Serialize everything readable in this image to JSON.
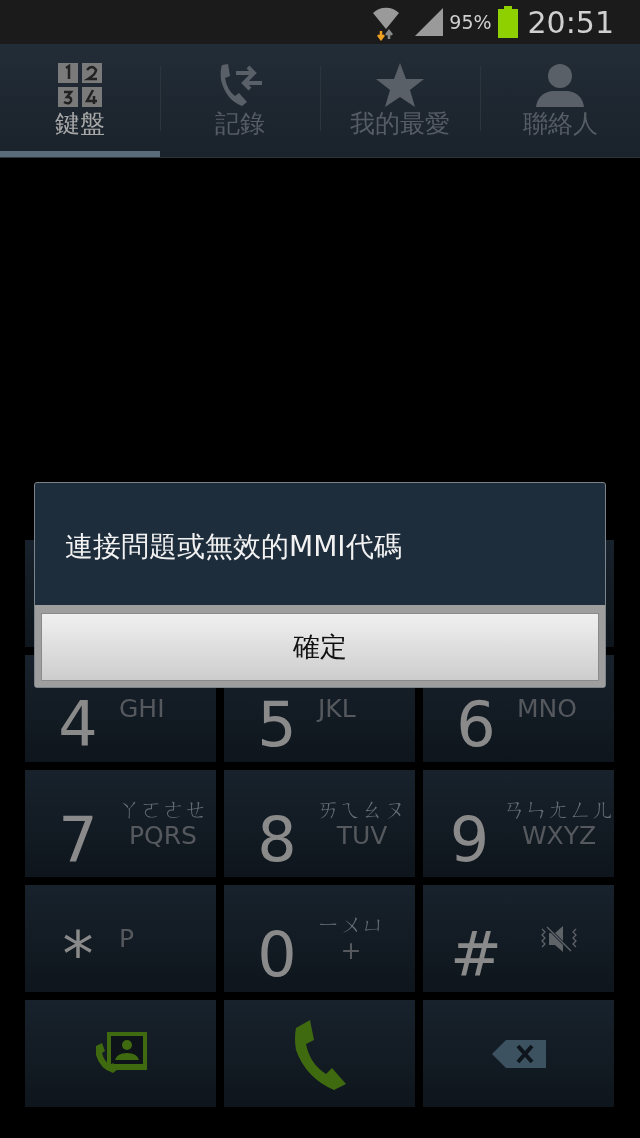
{
  "status_bar": {
    "battery": "95%",
    "time": "20:51"
  },
  "tabs": [
    {
      "label": "鍵盤",
      "selected": true
    },
    {
      "label": "記錄",
      "selected": false
    },
    {
      "label": "我的最愛",
      "selected": false
    },
    {
      "label": "聯絡人",
      "selected": false
    }
  ],
  "keypad": [
    {
      "kind": "digit",
      "digit": "4",
      "letters": "GHI"
    },
    {
      "kind": "digit",
      "digit": "5",
      "letters": "JKL"
    },
    {
      "kind": "digit",
      "digit": "6",
      "letters": "MNO"
    },
    {
      "kind": "digit",
      "digit": "7",
      "bopomofo": "ㄚㄛㄜㄝ",
      "letters": "PQRS"
    },
    {
      "kind": "digit",
      "digit": "8",
      "bopomofo": "ㄞㄟㄠㄡ",
      "letters": "TUV"
    },
    {
      "kind": "digit",
      "digit": "9",
      "bopomofo": "ㄢㄣㄤㄥㄦ",
      "letters": "WXYZ"
    },
    {
      "kind": "digit",
      "digit": "*",
      "letters": "P"
    },
    {
      "kind": "digit",
      "digit": "0",
      "bopomofo": "ㄧㄨㄩ",
      "letters": "+"
    },
    {
      "kind": "mute",
      "digit": "#"
    },
    {
      "kind": "contact-call"
    },
    {
      "kind": "call"
    },
    {
      "kind": "backspace"
    }
  ],
  "dialog": {
    "message": "連接問題或無效的MMI代碼",
    "button": "確定"
  }
}
